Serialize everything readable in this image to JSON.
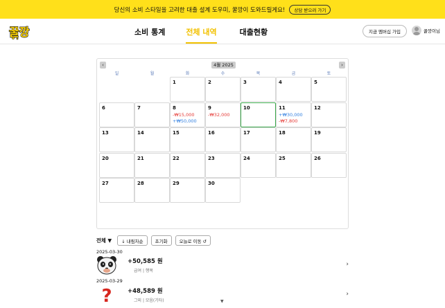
{
  "banner": {
    "text": "당신의 소비 스타일을 고려한 대출 설계 도우미, 꿀깡이 도와드릴게요!",
    "button_label": "상담 받으러 가기",
    "bg_color": "#ffe01a"
  },
  "header": {
    "logo_text": "꿀깡",
    "nav": [
      "소비 통계",
      "전체 내역",
      "대출현황"
    ],
    "active_nav": "전체 내역",
    "signup_label": "지금 멤버십 가입",
    "user_name": "꿀깡이님",
    "accent_color": "#f2c100"
  },
  "calendar": {
    "title": "4월 2025",
    "prev_icon": "‹",
    "next_icon": "›",
    "weekdays": [
      "일",
      "월",
      "화",
      "수",
      "목",
      "금",
      "토"
    ],
    "weeks": [
      [
        {
          "d": ""
        },
        {
          "d": ""
        },
        {
          "d": "1"
        },
        {
          "d": "2"
        },
        {
          "d": "3"
        },
        {
          "d": "4"
        },
        {
          "d": "5"
        }
      ],
      [
        {
          "d": "6"
        },
        {
          "d": "7"
        },
        {
          "d": "8",
          "amounts": [
            {
              "t": "-₩15,000",
              "k": "neg"
            },
            {
              "t": "+₩50,000",
              "k": "pos"
            }
          ]
        },
        {
          "d": "9",
          "amounts": [
            {
              "t": "-₩32,000",
              "k": "neg"
            }
          ]
        },
        {
          "d": "10",
          "today": true
        },
        {
          "d": "11",
          "amounts": [
            {
              "t": "+₩30,000",
              "k": "pos"
            },
            {
              "t": "-₩7,800",
              "k": "neg"
            }
          ]
        },
        {
          "d": "12"
        }
      ],
      [
        {
          "d": "13"
        },
        {
          "d": "14"
        },
        {
          "d": "15"
        },
        {
          "d": "16"
        },
        {
          "d": "17"
        },
        {
          "d": "18"
        },
        {
          "d": "19"
        }
      ],
      [
        {
          "d": "20"
        },
        {
          "d": "21"
        },
        {
          "d": "22"
        },
        {
          "d": "23"
        },
        {
          "d": "24"
        },
        {
          "d": "25"
        },
        {
          "d": "26"
        }
      ],
      [
        {
          "d": "27"
        },
        {
          "d": "28"
        },
        {
          "d": "29"
        },
        {
          "d": "30"
        }
      ]
    ],
    "colors": {
      "negative": "#e53935",
      "positive": "#2f7ee0",
      "today_border": "#3aa84a"
    }
  },
  "filters": {
    "all_label": "전체 ▼",
    "sort_label": "↓ 내림차순",
    "reset_label": "초기화",
    "today_label": "오늘로 이동 ↺"
  },
  "transactions": [
    {
      "date": "2025-03-30",
      "amount": "+50,585 원",
      "meta": "급여 | 행복",
      "icon": "panda-icon"
    },
    {
      "date": "2025-03-29",
      "amount": "+48,589 원",
      "meta": "그외 | 모음(기타)",
      "icon": "question-mark-icon"
    }
  ],
  "chevron": "›",
  "scroll_indicator": "▼"
}
